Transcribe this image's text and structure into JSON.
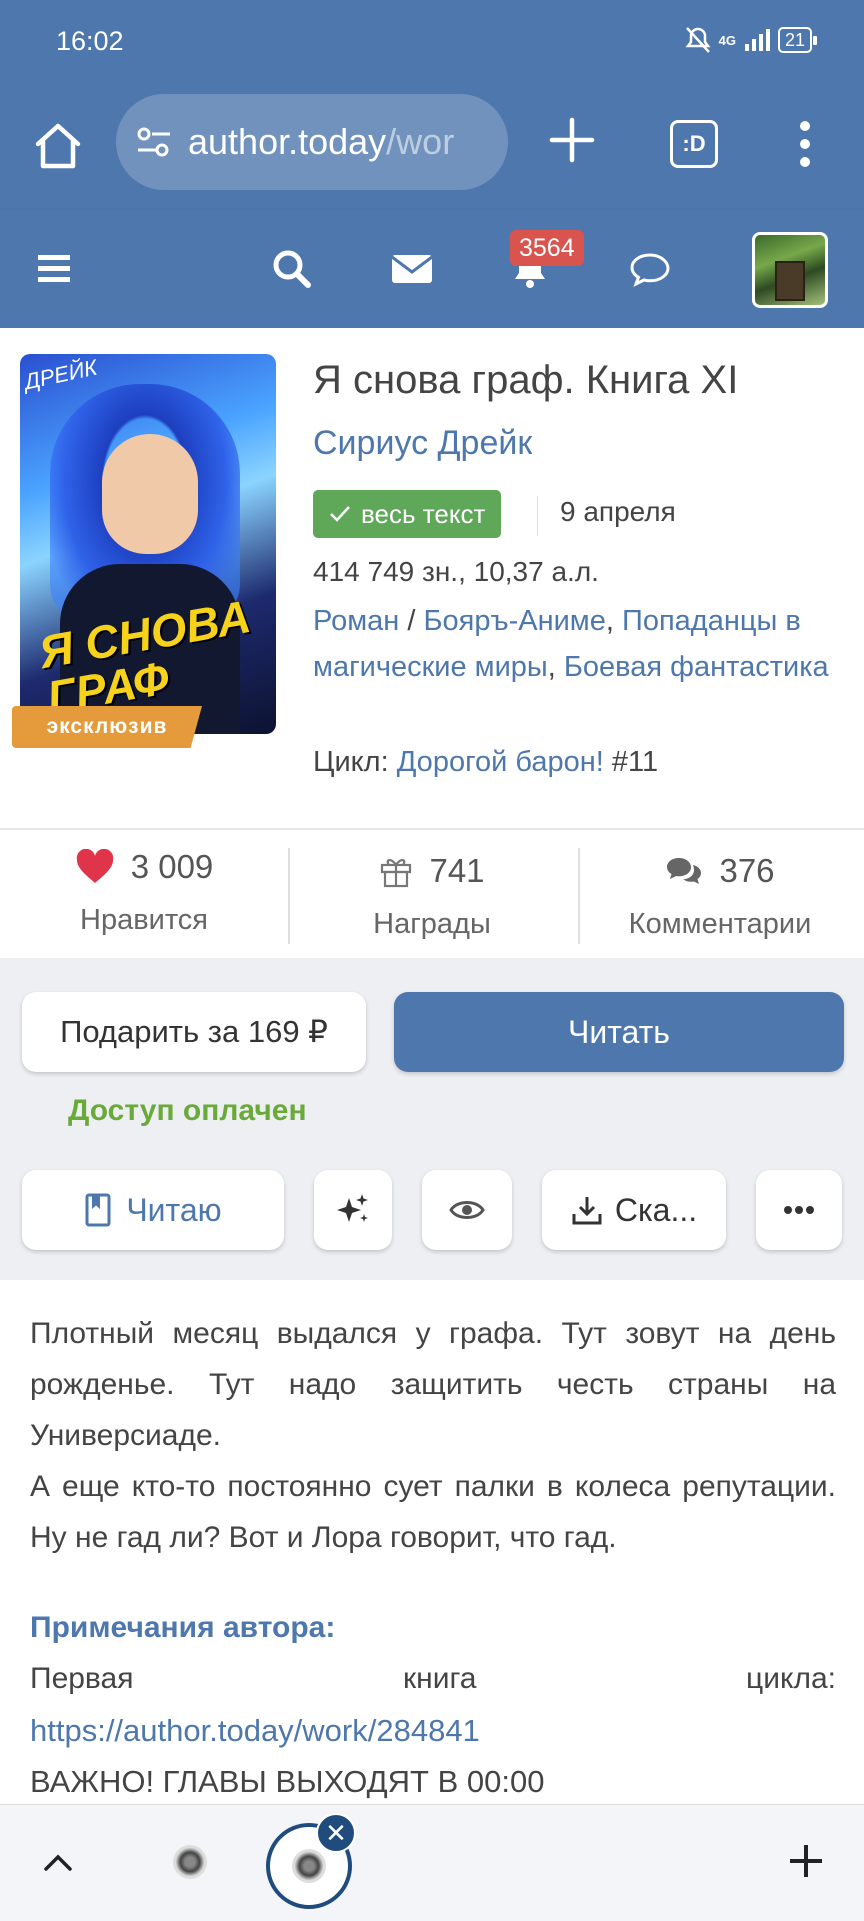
{
  "status_bar": {
    "time": "16:02",
    "network": "4G",
    "battery": "21"
  },
  "browser": {
    "url_host": "author.today",
    "url_path": "/wor",
    "tab_icon_text": ":D"
  },
  "site_nav": {
    "notifications_count": "3564"
  },
  "book": {
    "cover_title": "Я СНОВА ГРАФ",
    "cover_author": "ДРЕЙК",
    "exclusive_label": "эксклюзив",
    "title": "Я снова граф. Книга XI",
    "author": "Сириус Дрейк",
    "status_badge": "весь текст",
    "date": "9 апреля",
    "size": "414 749 зн., 10,37 а.л.",
    "genres": [
      {
        "label": "Роман"
      },
      {
        "label": "Бояръ-Аниме"
      },
      {
        "label": "Попаданцы в магические миры"
      },
      {
        "label": "Боевая фантастика"
      }
    ],
    "genre_separator": " / ",
    "genre_comma": ", ",
    "cycle_label": "Цикл:",
    "cycle_name": "Дорогой барон!",
    "cycle_number": "#11"
  },
  "stats": {
    "likes": {
      "value": "3 009",
      "label": "Нравится"
    },
    "awards": {
      "value": "741",
      "label": "Награды"
    },
    "comments": {
      "value": "376",
      "label": "Комментарии"
    }
  },
  "actions": {
    "gift_label": "Подарить за 169 ₽",
    "read_label": "Читать",
    "paid_status": "Доступ оплачен",
    "reading_label": "Читаю",
    "download_label": "Ска..."
  },
  "description": {
    "paragraph_1": "Плотный месяц выдался у графа. Тут зовут на день рожденье. Тут надо защитить честь страны на Универсиаде.",
    "paragraph_2": "А еще кто-то постоянно сует палки в колеса репутации. Ну не гад ли? Вот и Лора говорит, что гад.",
    "notes_heading": "Примечания автора:",
    "notes_words": [
      "Первая",
      "книга",
      "цикла:"
    ],
    "notes_link": "https://author.today/work/284841",
    "notes_important": "ВАЖНО! ГЛАВЫ ВЫХОДЯТ В 00:00"
  },
  "colors": {
    "brand": "#4d77ad",
    "badge_green": "#5fa85a",
    "paid_green": "#6aaa3a",
    "exclusive_orange": "#e59b3b",
    "notification_red": "#d9534f"
  },
  "icons": {
    "browser": [
      "home-icon",
      "site-settings-icon",
      "new-tab-icon",
      "tab-switcher-icon",
      "more-vert-icon"
    ],
    "site_nav": [
      "hamburger-icon",
      "search-icon",
      "mail-icon",
      "bell-icon",
      "chat-icon"
    ],
    "stats": [
      "heart-icon",
      "gift-icon",
      "comments-icon"
    ],
    "actions": [
      "bookmark-icon",
      "sparkle-icon",
      "eye-icon",
      "download-icon",
      "more-horiz-icon"
    ],
    "bottom": [
      "chevron-up-icon",
      "tab-crest-icon",
      "close-icon",
      "plus-icon"
    ]
  }
}
